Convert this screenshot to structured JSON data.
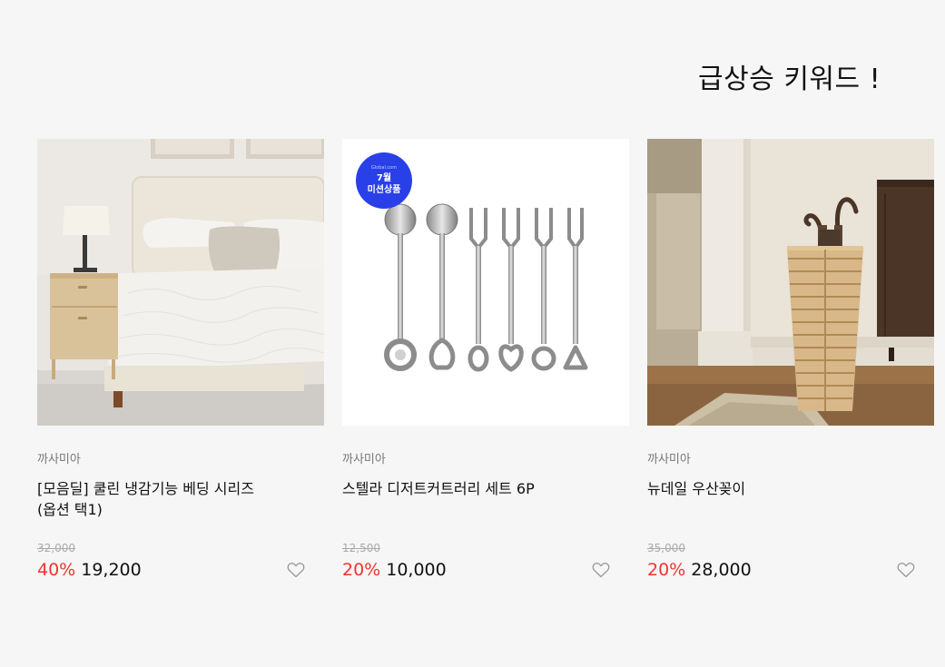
{
  "section": {
    "title": "급상승 키워드 !"
  },
  "products": [
    {
      "brand": "까사미아",
      "name": "[모음딜] 쿨린 냉감기능 베딩 시리즈 (옵션 택1)",
      "original_price": "32,000",
      "discount": "40%",
      "sale_price": "19,200",
      "image": "bed-with-white-bedding-photo"
    },
    {
      "brand": "까사미아",
      "name": "스텔라 디저트커트러리 세트 6P",
      "original_price": "12,500",
      "discount": "20%",
      "sale_price": "10,000",
      "image": "dessert-cutlery-set-photo",
      "badge": {
        "sub": "Global.com",
        "line1": "7월",
        "line2": "미션상품",
        "color": "#2940e8"
      }
    },
    {
      "brand": "까사미아",
      "name": "뉴데일 우산꽂이",
      "original_price": "35,000",
      "discount": "20%",
      "sale_price": "28,000",
      "image": "wooden-umbrella-stand-photo"
    }
  ],
  "colors": {
    "background": "#f6f6f6",
    "discount": "#f0342f",
    "badge": "#2940e8"
  }
}
